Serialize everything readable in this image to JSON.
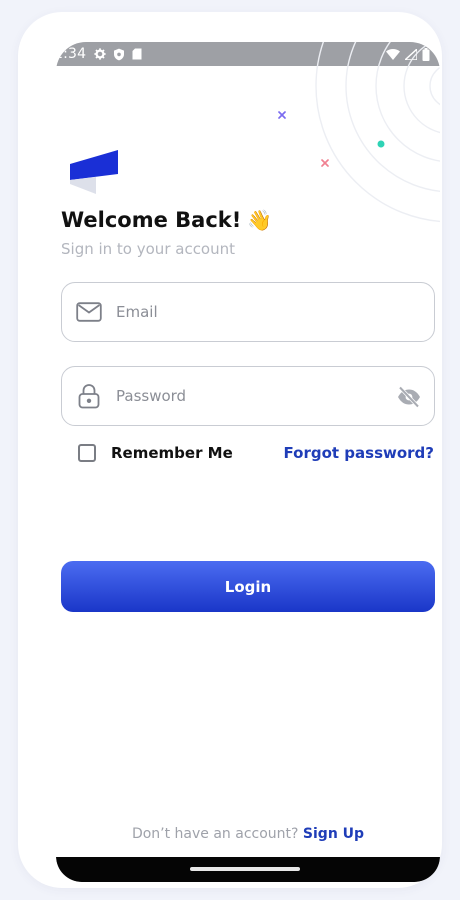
{
  "status_bar": {
    "time": "1:34"
  },
  "auth": {
    "title": "Welcome Back!",
    "title_emoji": "👋",
    "subtitle": "Sign in to your account",
    "email_placeholder": "Email",
    "password_placeholder": "Password",
    "remember_label": "Remember Me",
    "remember_checked": false,
    "forgot_label": "Forgot password?",
    "login_label": "Login",
    "signup_prompt": "Don’t have an account?",
    "signup_label": "Sign Up"
  },
  "colors": {
    "accent": "#1f3db8",
    "button_top": "#4b6cf1",
    "button_bottom": "#1a36c8",
    "status_bar": "#9ea0a5",
    "deco_x_purple": "#7b6cf0",
    "deco_x_red": "#f08090",
    "deco_dot_teal": "#2ed3b5"
  },
  "icons": {
    "status": [
      "gear-icon",
      "shield-icon",
      "sd-card-icon",
      "wifi-icon",
      "signal-icon",
      "battery-icon"
    ],
    "email_field": "envelope-icon",
    "password_field": "lock-icon",
    "password_toggle": "eye-off-icon"
  }
}
